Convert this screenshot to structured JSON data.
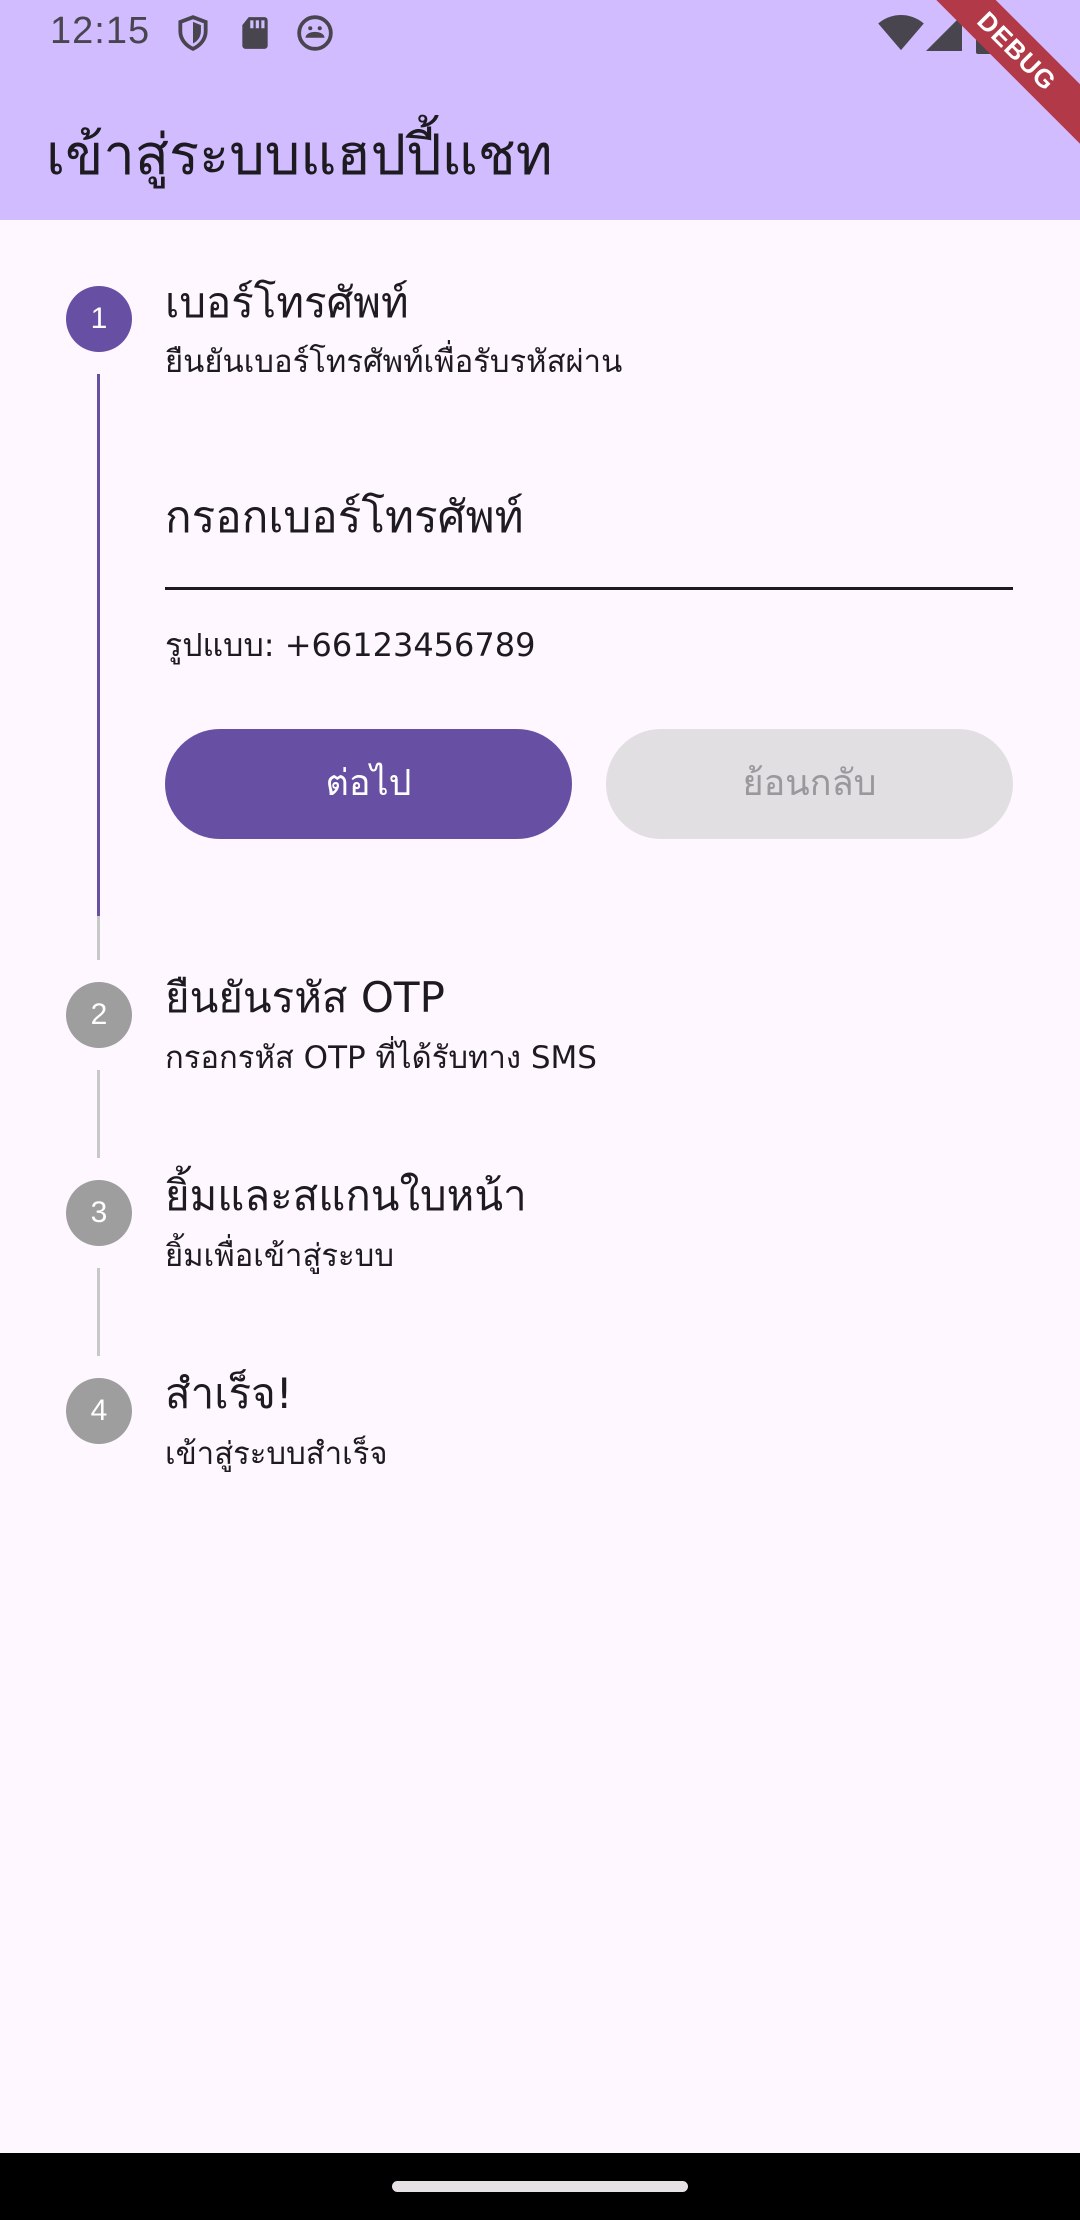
{
  "status_bar": {
    "time": "12:15",
    "left_icons": [
      "shield-icon",
      "sd-card-icon",
      "android-face-icon"
    ],
    "right_icons": [
      "wifi-icon",
      "signal-icon",
      "battery-icon"
    ]
  },
  "app_bar": {
    "title": "เข้าสู่ระบบแฮปปี้แชท",
    "background": "#D0BCFF",
    "debug_banner": "DEBUG"
  },
  "stepper": {
    "active_color": "#6750A4",
    "inactive_color": "#9E9E9E",
    "steps": [
      {
        "number": "1",
        "title": "เบอร์โทรศัพท์",
        "subtitle": "ยืนยันเบอร์โทรศัพท์เพื่อรับรหัสผ่าน",
        "state": "active"
      },
      {
        "number": "2",
        "title": "ยืนยันรหัส OTP",
        "subtitle": "กรอกรหัส OTP ที่ได้รับทาง SMS",
        "state": "inactive"
      },
      {
        "number": "3",
        "title": "ยิ้มและสแกนใบหน้า",
        "subtitle": "ยิ้มเพื่อเข้าสู่ระบบ",
        "state": "inactive"
      },
      {
        "number": "4",
        "title": "สำเร็จ!",
        "subtitle": "เข้าสู่ระบบสำเร็จ",
        "state": "inactive"
      }
    ]
  },
  "phone_form": {
    "label": "กรอกเบอร์โทรศัพท์",
    "value": "",
    "helper": "รูปแบบ: +66123456789",
    "next_label": "ต่อไป",
    "back_label": "ย้อนกลับ"
  }
}
